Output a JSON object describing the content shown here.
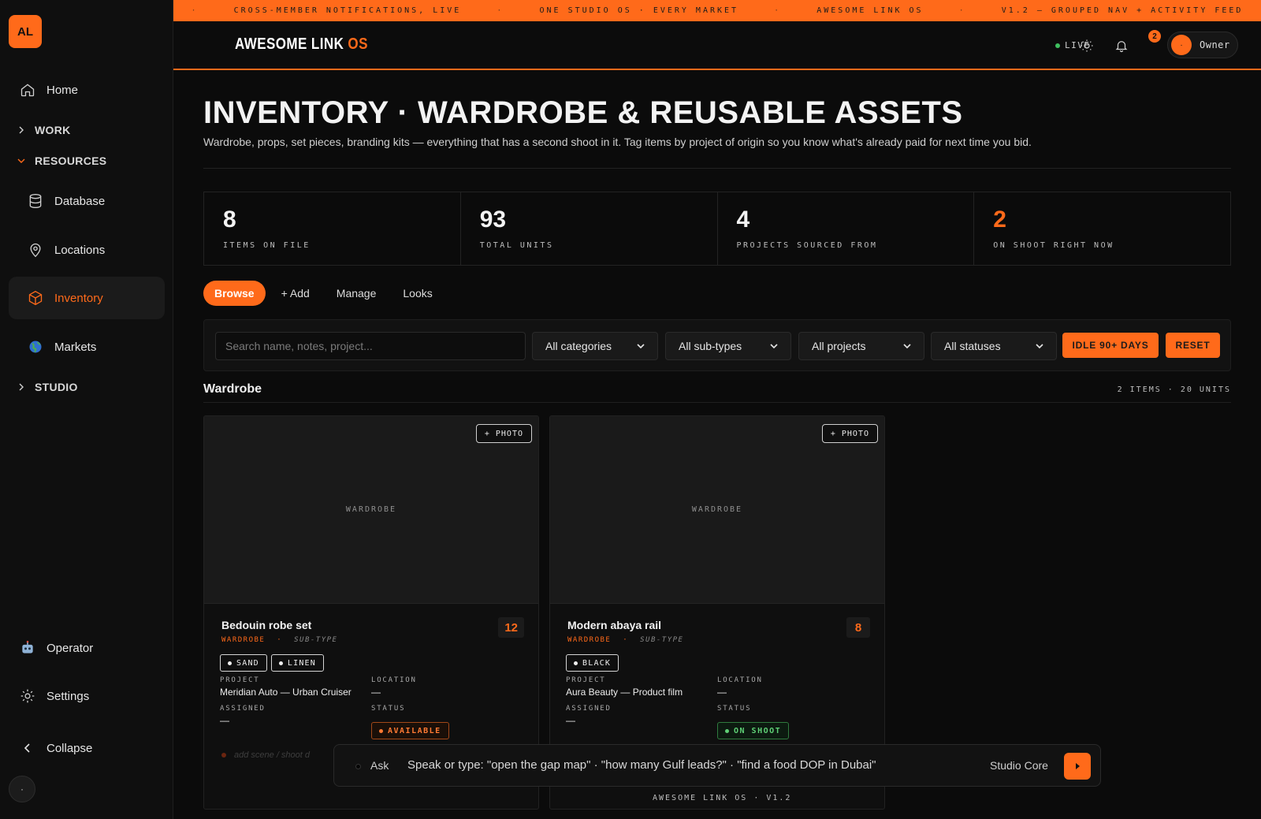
{
  "sidebar": {
    "logo": "AL",
    "home": "Home",
    "work": "WORK",
    "resources": "RESOURCES",
    "database": "Database",
    "locations": "Locations",
    "inventory": "Inventory",
    "markets": "Markets",
    "studio": "STUDIO",
    "operator": "Operator",
    "settings": "Settings",
    "collapse": "Collapse",
    "mini": "·"
  },
  "ticker": [
    "CROSS-MEMBER NOTIFICATIONS, LIVE",
    "ONE STUDIO OS · EVERY MARKET",
    "AWESOME LINK OS",
    "V1.2 — GROUPED NAV + ACTIVITY FEED"
  ],
  "ticker_sep": "·",
  "header": {
    "brand_main": "AWESOME LINK ",
    "brand_accent": "OS",
    "live": "LIVE",
    "notif_count": "2",
    "owner_avatar": "·",
    "owner": "Owner"
  },
  "page": {
    "title": "INVENTORY · WARDROBE & REUSABLE ASSETS",
    "subtitle": "Wardrobe, props, set pieces, branding kits — everything that has a second shoot in it. Tag items by project of origin so you know what's already paid for next time you bid."
  },
  "stats": [
    {
      "value": "8",
      "label": "ITEMS ON FILE"
    },
    {
      "value": "93",
      "label": "TOTAL UNITS"
    },
    {
      "value": "4",
      "label": "PROJECTS SOURCED FROM"
    },
    {
      "value": "2",
      "label": "ON SHOOT RIGHT NOW"
    }
  ],
  "tabs": [
    "Browse",
    "+ Add",
    "Manage",
    "Looks"
  ],
  "filters": {
    "search_placeholder": "Search name, notes, project...",
    "categories": "All categories",
    "subtypes": "All sub-types",
    "projects": "All projects",
    "statuses": "All statuses",
    "idle": "IDLE 90+ DAYS",
    "reset": "RESET"
  },
  "section": {
    "title": "Wardrobe",
    "meta": "2 ITEMS · 20 UNITS"
  },
  "cards": [
    {
      "photo_btn": "+ PHOTO",
      "placeholder": "WARDROBE",
      "name": "Bedouin robe set",
      "qty": "12",
      "category": "WARDROBE",
      "cat_sep": "·",
      "subtype": "SUB-TYPE",
      "tags": [
        "SAND",
        "LINEN"
      ],
      "project_label": "PROJECT",
      "project": "Meridian Auto — Urban Cruiser",
      "location_label": "LOCATION",
      "location": "—",
      "assigned_label": "ASSIGNED",
      "assigned": "—",
      "status_label": "STATUS",
      "status": "AVAILABLE",
      "ghost": "add scene / shoot d"
    },
    {
      "photo_btn": "+ PHOTO",
      "placeholder": "WARDROBE",
      "name": "Modern abaya rail",
      "qty": "8",
      "category": "WARDROBE",
      "cat_sep": "·",
      "subtype": "SUB-TYPE",
      "tags": [
        "BLACK"
      ],
      "project_label": "PROJECT",
      "project": "Aura Beauty — Product film",
      "location_label": "LOCATION",
      "location": "—",
      "assigned_label": "ASSIGNED",
      "assigned": "—",
      "status_label": "STATUS",
      "status": "ON SHOOT"
    }
  ],
  "ask": {
    "label": "Ask",
    "placeholder": "Speak or type: \"open the gap map\" · \"how many Gulf leads?\" · \"find a food DOP in Dubai\"",
    "model": "Studio Core"
  },
  "footer": "AWESOME LINK OS · V1.2",
  "colors": {
    "accent": "#ff6a1a",
    "available": "#ff7a33",
    "on_shoot": "#5fd076",
    "live": "#3fbf5f"
  }
}
